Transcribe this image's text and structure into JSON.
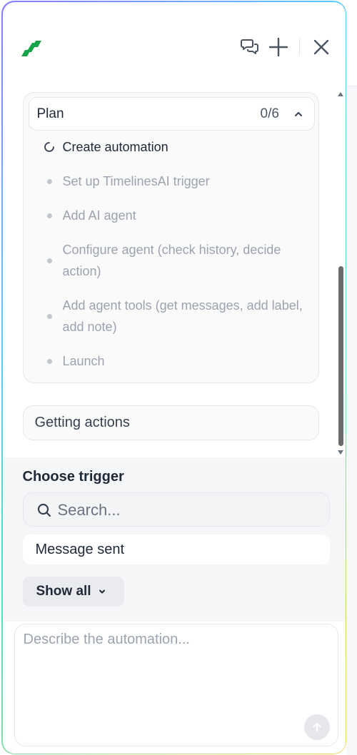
{
  "header": {
    "logo_icon": "n8n-style-slash-logo",
    "chat_history_icon": "chat-bubbles-icon",
    "new_chat_icon": "plus-icon",
    "close_icon": "close-icon",
    "brand_color": "#16a34a"
  },
  "plan": {
    "title": "Plan",
    "progress": "0/6",
    "steps": [
      {
        "label": "Create automation",
        "status": "in-progress"
      },
      {
        "label": "Set up TimelinesAI trigger",
        "status": "pending"
      },
      {
        "label": "Add AI agent",
        "status": "pending"
      },
      {
        "label": "Configure agent (check history, decide action)",
        "status": "pending"
      },
      {
        "label": "Add agent tools (get messages, add label, add note)",
        "status": "pending"
      },
      {
        "label": "Launch",
        "status": "pending"
      }
    ]
  },
  "status_message": "Getting actions",
  "trigger": {
    "title": "Choose trigger",
    "search_placeholder": "Search...",
    "search_value": "",
    "items": [
      "Message sent"
    ],
    "show_all_label": "Show all"
  },
  "composer": {
    "placeholder": "Describe the automation...",
    "value": "",
    "send_icon": "arrow-up-icon"
  }
}
